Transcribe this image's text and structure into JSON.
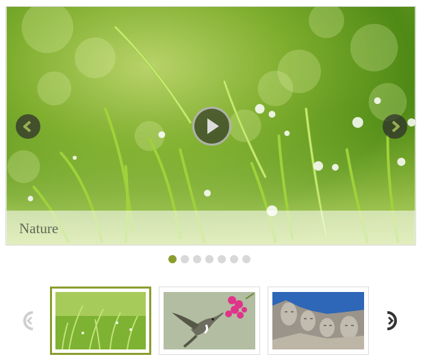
{
  "slider": {
    "caption": "Nature",
    "prev_icon": "chevron-left-icon",
    "next_icon": "chevron-right-icon",
    "play_icon": "play-icon",
    "slide_count": 7,
    "active_slide": 1
  },
  "thumbnails": {
    "items": [
      {
        "subject": "grass-with-dew",
        "active": true
      },
      {
        "subject": "hummingbird-with-pink-flowers",
        "active": false
      },
      {
        "subject": "mount-rushmore",
        "active": false
      }
    ],
    "prev_icon": "circle-arrow-left-icon",
    "next_icon": "circle-arrow-right-icon"
  },
  "colors": {
    "accent": "#8a9e2f",
    "dot_inactive": "#d8d8d8",
    "arrow_bg": "#2d2d2d"
  }
}
